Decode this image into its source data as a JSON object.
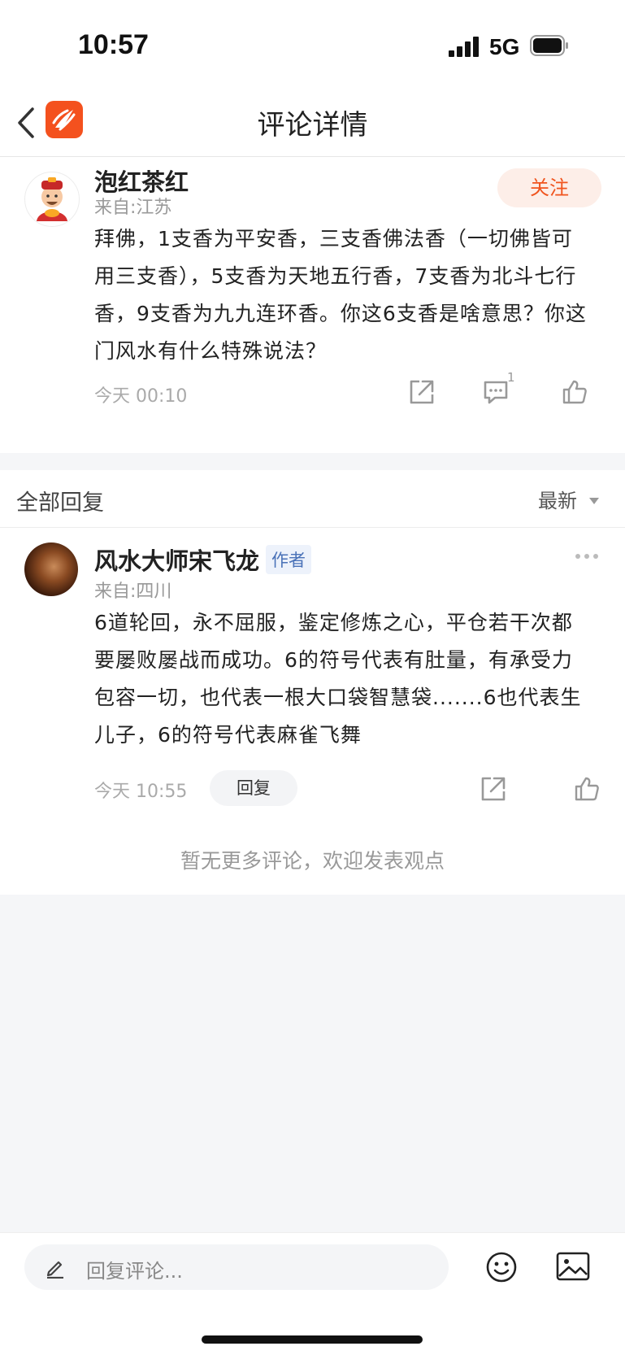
{
  "status_bar": {
    "time": "10:57",
    "network": "5G"
  },
  "nav": {
    "title": "评论详情"
  },
  "comment": {
    "username": "泡红茶红",
    "location": "来自:江苏",
    "follow_label": "关注",
    "text": "拜佛，1支香为平安香，三支香佛法香（一切佛皆可用三支香），5支香为天地五行香，7支香为北斗七行香，9支香为九九连环香。你这6支香是啥意思？你这门风水有什么特殊说法？",
    "time": "今天 00:10",
    "reply_count": "1"
  },
  "replies_section": {
    "title": "全部回复",
    "sort_label": "最新"
  },
  "reply": {
    "username": "风水大师宋飞龙",
    "author_tag": "作者",
    "location": "来自:四川",
    "text": "6道轮回，永不屈服，鉴定修炼之心，平仓若干次都要屡败屡战而成功。6的符号代表有肚量，有承受力包容一切，也代表一根大口袋智慧袋.......6也代表生儿子，6的符号代表麻雀飞舞",
    "time": "今天 10:55",
    "reply_label": "回复"
  },
  "no_more": "暂无更多评论，欢迎发表观点",
  "bottom_bar": {
    "input_placeholder": "回复评论..."
  },
  "colors": {
    "accent": "#f0541e",
    "author_tag": "#4a72b8",
    "background": "#f5f6f8"
  },
  "icons": [
    "back-icon",
    "app-logo",
    "share-icon",
    "comment-icon",
    "like-icon",
    "more-icon",
    "pencil-icon",
    "emoji-icon",
    "image-icon"
  ]
}
